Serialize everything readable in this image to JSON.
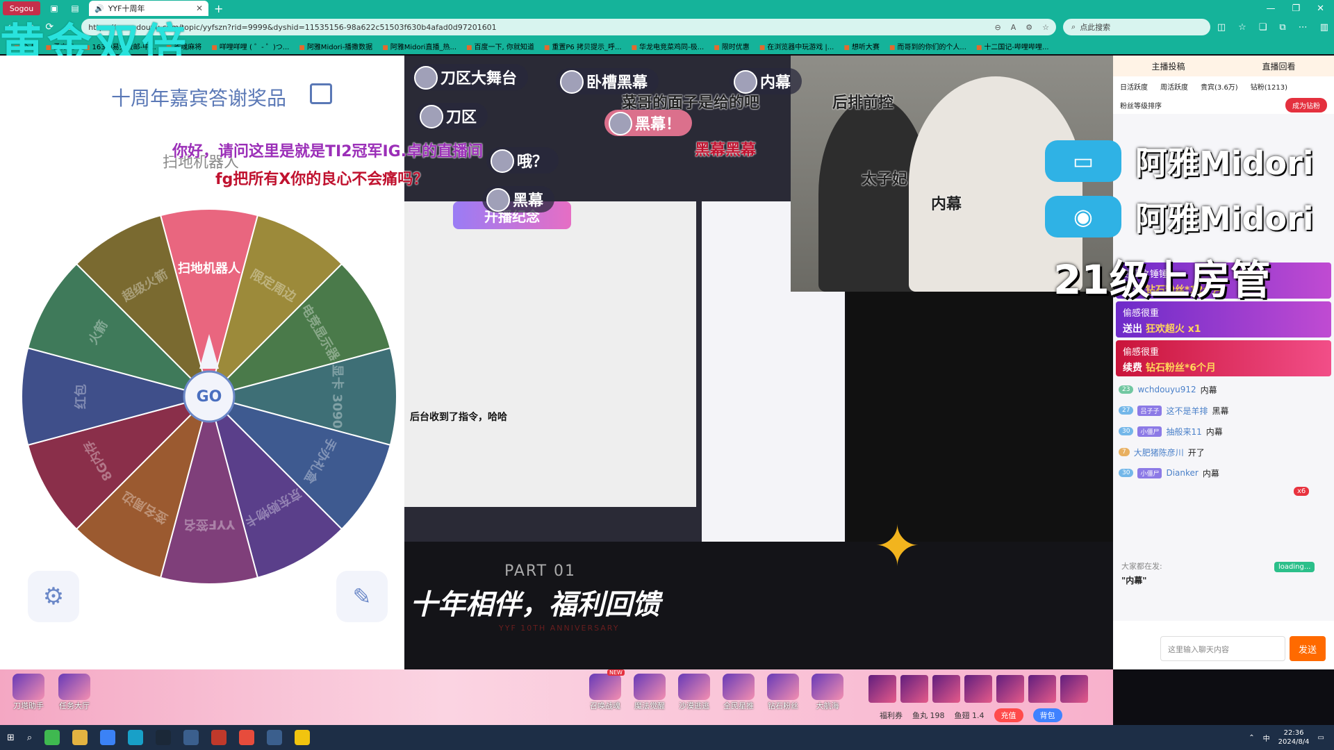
{
  "overlay_title": "黄金双倍",
  "browser": {
    "app_badge": "Sogou",
    "tab_title": "YYF十周年",
    "url": "https://www.douyu.com/topic/yyfszn?rid=9999&dyshid=11535156-98a622c51503f630b4afad0d97201601",
    "search_placeholder": "点此搜索",
    "bookmarks": [
      "个人",
      "勇夯娃",
      "163网易免费邮-中...",
      "雀魂麻将",
      "咩哩咩哩 ( ゜- ゜)つ...",
      "阿雅Midori-播撒数据",
      "阿雅Midori直播_热...",
      "百度一下, 你就知道",
      "重置P6 拷贝提示_呼...",
      "华龙电竞菜鸡同-极...",
      "限时优惠",
      "在浏览器中玩游戏 |...",
      "想听大赛",
      "而哥到的你们的个人...",
      "十二国记-哔哩哔哩..."
    ]
  },
  "wheel": {
    "title": "十周年嘉宾答谢奖品",
    "result_label": "扫地机器人",
    "go_label": "GO",
    "segments": [
      "扫地机器人",
      "限定周边",
      "电竞显示器",
      "显卡 3090",
      "手办礼盒",
      "京东购物卡",
      "YYF签名",
      "签名周边",
      "8G内存",
      "红包",
      "火箭",
      "超级火箭"
    ]
  },
  "danmaku": [
    {
      "text": "刀区大舞台",
      "style": "pill"
    },
    {
      "text": "卧槽黑幕",
      "style": "pill"
    },
    {
      "text": "内幕",
      "style": "pill"
    },
    {
      "text": "菜哥的面子是给的吧",
      "style": "plain"
    },
    {
      "text": "刀区",
      "style": "pill"
    },
    {
      "text": "黑幕！",
      "style": "pill-pink"
    },
    {
      "text": "哦？",
      "style": "pill"
    },
    {
      "text": "黑幕",
      "style": "pill"
    },
    {
      "text": "你好，请问这里是就是TI2冠军IG.卓的直播间",
      "style": "purple"
    },
    {
      "text": "fg把所有X你的良心不会痛吗？",
      "style": "red"
    },
    {
      "text": "后排前控",
      "style": "plain"
    },
    {
      "text": "黑幕黑幕",
      "style": "red"
    },
    {
      "text": "太子妃",
      "style": "plain"
    },
    {
      "text": "内幕",
      "style": "plain"
    }
  ],
  "stream": {
    "inner_banner": "开播纪念",
    "part_label": "PART 01",
    "slogan": "十年相伴，福利回馈",
    "anniversary": "YYF 10TH ANNIVERSARY",
    "screen_quote": "后台收到了指令，哈哈"
  },
  "social": [
    {
      "platform": "bilibili-icon",
      "name": "阿雅Midori"
    },
    {
      "platform": "weibo-icon",
      "name": "阿雅Midori"
    }
  ],
  "admin_caption": "21级上房管",
  "chat_panel": {
    "tabs": [
      "主播投稿",
      "直播回看"
    ],
    "subtabs": [
      "日活跃度",
      "周活跃度",
      "贵宾(3.6万)",
      "钻粉(1213)"
    ],
    "rank_label": "粉丝等级排序",
    "rank_button": "成为钻粉",
    "banners": [
      {
        "title": "毁灭之锤锤",
        "line": "开通",
        "highlight": "钻石粉丝*12个月",
        "style": "purple"
      },
      {
        "title": "偷感很重",
        "line": "送出",
        "highlight": "狂欢超火 x1",
        "style": "purple"
      },
      {
        "title": "偷感很重",
        "line": "续费",
        "highlight": "钻石粉丝*6个月",
        "style": "red"
      }
    ],
    "messages": [
      {
        "level": "23",
        "user": "wchdouyu912",
        "text": "内幕"
      },
      {
        "level": "27",
        "badge": "吕子子",
        "user": "这不是羊排",
        "text": "黑幕"
      },
      {
        "level": "30",
        "badge": "小僵尸",
        "user": "抽般来11",
        "text": "内幕"
      },
      {
        "level": "7",
        "user": "大肥猪陈彦川",
        "text": "开了"
      },
      {
        "level": "30",
        "badge": "小僵尸",
        "user": "Dianker",
        "text": "内幕"
      }
    ],
    "everyone_label": "大家都在发:",
    "everyone_text": "\"内幕\"",
    "loading": "loading...",
    "multiplier": "x6",
    "input_placeholder": "这里输入聊天内容",
    "send_label": "发送"
  },
  "gift_bar": {
    "left": [
      {
        "label": "刀塔助手",
        "icon": "dota-icon"
      },
      {
        "label": "任务大厅",
        "icon": "task-icon"
      }
    ],
    "tools": [
      {
        "label": "召唤战魂",
        "badge": "NEW"
      },
      {
        "label": "魔法觉醒"
      },
      {
        "label": "沙漠逃逃"
      },
      {
        "label": "全民星推"
      },
      {
        "label": "钻石粉丝"
      },
      {
        "label": "大航海"
      }
    ],
    "wallet": {
      "benefit": "福利券",
      "fish_ball": "鱼丸 198",
      "fish_wing": "鱼翅 1.4",
      "charge": "充值",
      "backpack": "背包"
    }
  },
  "taskbar": {
    "time": "22:36",
    "date": "2024/8/4",
    "lang": "中"
  },
  "colors": {
    "chrome": "#15b39a",
    "overlay_title": "#29e3dd",
    "wheel_selected": "#e9667f"
  }
}
